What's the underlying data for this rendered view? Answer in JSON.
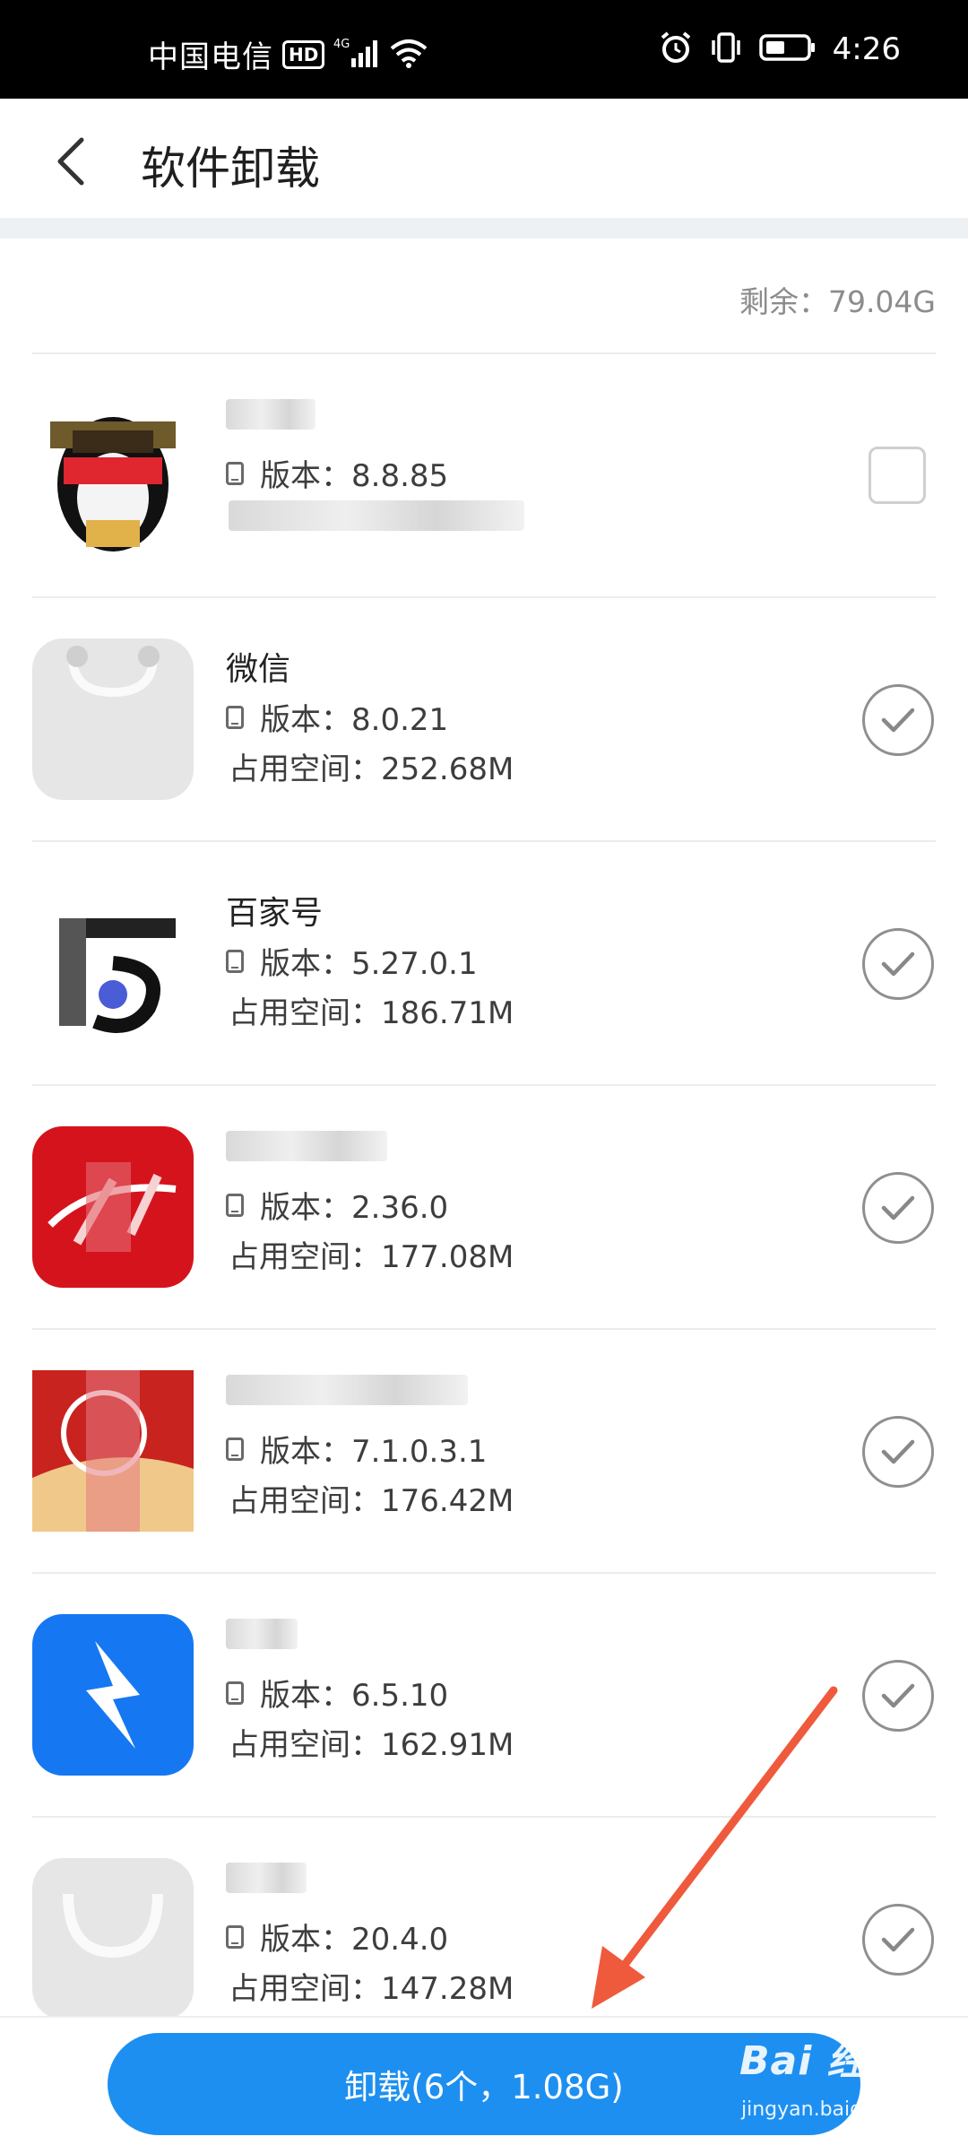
{
  "status_bar": {
    "carrier": "中国电信",
    "hd": "HD",
    "network": "4G",
    "time": "4:26"
  },
  "header": {
    "title": "软件卸载"
  },
  "storage": {
    "remaining": "剩余：79.04G"
  },
  "apps": [
    {
      "name": "QQ",
      "version": "版本：8.8.85",
      "size": "",
      "checked": false,
      "icon": "penguin-icon",
      "color": "#111111"
    },
    {
      "name": "微信",
      "version": "版本：8.0.21",
      "size": "占用空间：252.68M",
      "checked": true,
      "icon": "bag-icon",
      "color": "#e6e6e6"
    },
    {
      "name": "百家号",
      "version": "版本：5.27.0.1",
      "size": "占用空间：186.71M",
      "checked": true,
      "icon": "baijiahao-icon",
      "color": "#2b2b2b"
    },
    {
      "name": "",
      "version": "版本：2.36.0",
      "size": "占用空间：177.08M",
      "checked": true,
      "icon": "red-app-icon",
      "color": "#d5131d"
    },
    {
      "name": "",
      "version": "版本：7.1.0.3.1",
      "size": "占用空间：176.42M",
      "checked": true,
      "icon": "red-gold-app-icon",
      "color": "#c8231f"
    },
    {
      "name": "",
      "version": "版本：6.5.10",
      "size": "占用空间：162.91M",
      "checked": true,
      "icon": "blue-bolt-icon",
      "color": "#1677f2"
    },
    {
      "name": "",
      "version": "版本：20.4.0",
      "size": "占用空间：147.28M",
      "checked": true,
      "icon": "bag-icon",
      "color": "#e6e6e6"
    }
  ],
  "footer": {
    "uninstall_label": "卸载(6个，1.08G)"
  },
  "watermark": {
    "main": "Bai 经验",
    "sub": "jingyan.baidu.com"
  }
}
